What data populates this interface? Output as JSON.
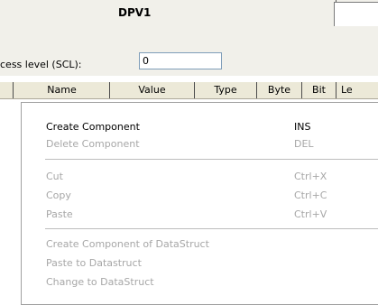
{
  "header": {
    "title": "DPV1",
    "access_label": "cess level (SCL):",
    "access_value": "0"
  },
  "grid": {
    "columns": [
      "Name",
      "Value",
      "Type",
      "Byte",
      "Bit",
      "Le"
    ]
  },
  "context_menu": {
    "items": [
      {
        "label": "Create Component",
        "shortcut": "INS",
        "enabled": true
      },
      {
        "label": "Delete Component",
        "shortcut": "DEL",
        "enabled": false
      },
      {
        "label": "Cut",
        "shortcut": "Ctrl+X",
        "enabled": false
      },
      {
        "label": "Copy",
        "shortcut": "Ctrl+C",
        "enabled": false
      },
      {
        "label": "Paste",
        "shortcut": "Ctrl+V",
        "enabled": false
      },
      {
        "label": "Create Component of DataStruct",
        "shortcut": "",
        "enabled": false
      },
      {
        "label": "Paste to Datastruct",
        "shortcut": "",
        "enabled": false
      },
      {
        "label": "Change to DataStruct",
        "shortcut": "",
        "enabled": false
      }
    ]
  }
}
